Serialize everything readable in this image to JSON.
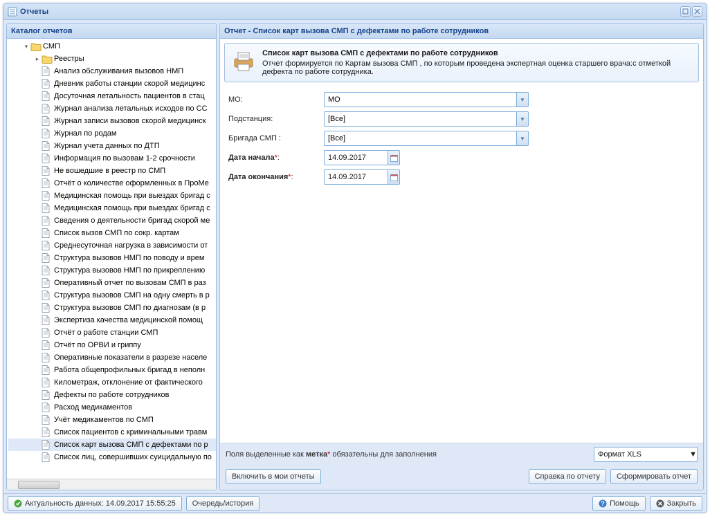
{
  "window": {
    "title": "Отчеты"
  },
  "catalog": {
    "title": "Каталог отчетов",
    "root": "СМП",
    "registries": "Реестры",
    "items": [
      "Анализ обслуживания вызовов НМП",
      "Дневник работы станции скорой медицинс",
      "Досуточная летальность пациентов в стац",
      "Журнал анализа летальных исходов по СС",
      "Журнал записи вызовов скорой медицинск",
      "Журнал по родам",
      "Журнал учета данных по ДТП",
      "Информация по вызовам 1-2 срочности",
      "Не вошедшие в реестр по СМП",
      "Отчёт о количестве оформленных в ПроМе",
      "Медицинская помощь при выездах бригад с",
      "Медицинская помощь при выездах бригад с",
      "Сведения о деятельности бригад скорой ме",
      "Список вызов СМП по сокр. картам",
      "Среднесуточная нагрузка в зависимости от",
      "Структура вызовов НМП по поводу и врем",
      "Структура вызовов НМП по прикреплению",
      "Оперативный отчет по вызовам СМП в раз",
      "Структура вызовов СМП на одну смерть в р",
      "Структура вызовов СМП по диагнозам (в р",
      "Экспертиза качества медицинской помощ",
      "Отчёт о работе станции СМП",
      "Отчёт по ОРВИ и гриппу",
      "Оперативные показатели в разрезе населе",
      "Работа общепрофильных бригад в неполн",
      "Километраж, отклонение от фактического",
      "Дефекты по работе сотрудников",
      "Расход медикаментов",
      "Учёт медикаментов по СМП",
      "Список пациентов с криминальными травм",
      "Список карт вызова СМП с дефектами по р",
      "Список лиц, совершивших суицидальную по"
    ],
    "selected_index": 30
  },
  "report": {
    "header": "Отчет - Список карт вызова СМП с дефектами по работе сотрудников",
    "desc_title": "Список карт вызова СМП с дефектами по работе сотрудников",
    "desc_body": "Отчет формируется по Картам вызова СМП , по которым проведена экспертная оценка старшего врача:с отметкой дефекта по работе сотрудника."
  },
  "form": {
    "mo_label": "МО:",
    "mo_value": "МО",
    "substation_label": "Подстанция:",
    "substation_value": "[Все]",
    "brigade_label": "Бригада СМП :",
    "brigade_value": "[Все]",
    "date_start_label": "Дата начала",
    "date_start_value": "14.09.2017",
    "date_end_label": "Дата окончания",
    "date_end_value": "14.09.2017"
  },
  "hint": {
    "prefix": "Поля выделенные как ",
    "bold": "метка",
    "suffix": " обязательны для заполнения",
    "format_value": "Формат XLS"
  },
  "buttons": {
    "include": "Включить в мои отчеты",
    "help_report": "Справка по отчету",
    "generate": "Сформировать отчет",
    "help": "Помощь",
    "close": "Закрыть",
    "queue": "Очередь/история"
  },
  "status": {
    "actuality": "Актуальность данных: 14.09.2017 15:55:25"
  }
}
